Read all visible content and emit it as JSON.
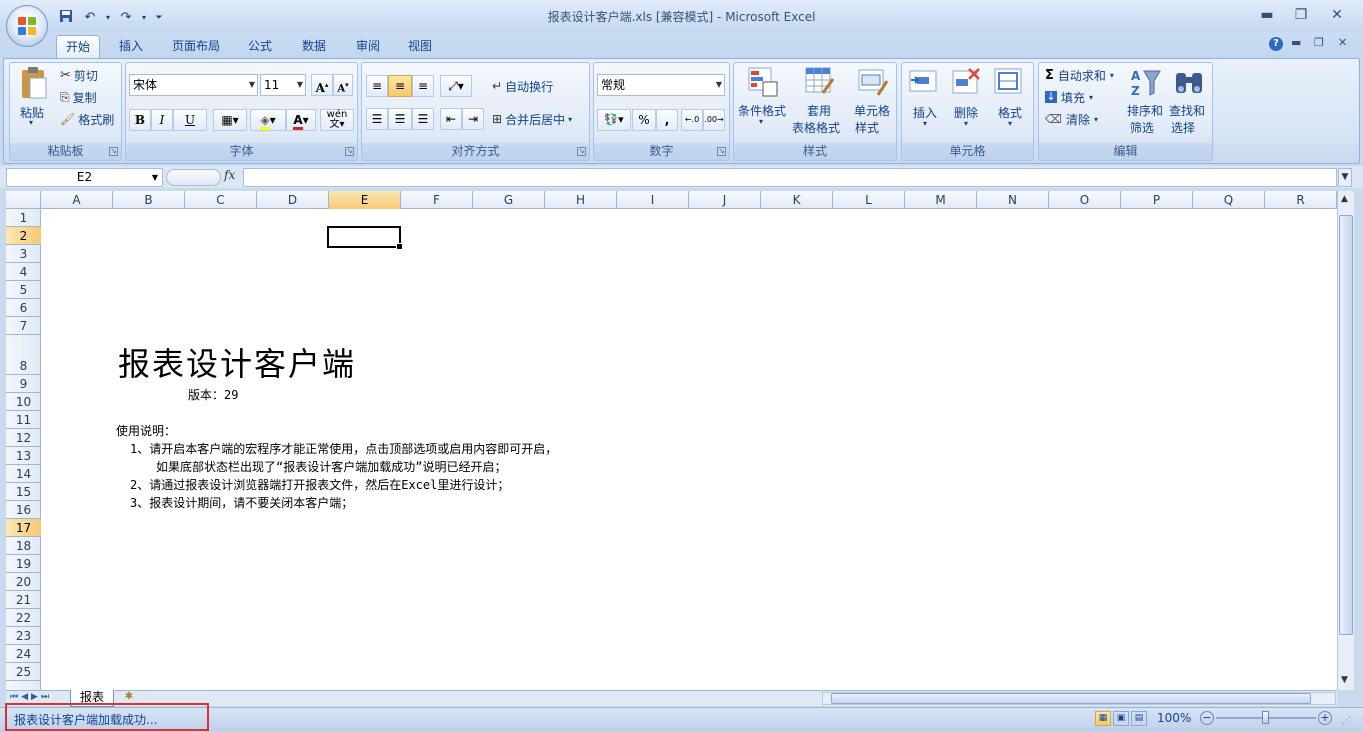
{
  "window": {
    "title": "报表设计客户端.xls  [兼容模式] - Microsoft Excel",
    "controls": {
      "minimize": "▬",
      "restore": "❐",
      "close": "✕"
    }
  },
  "quick_access": {
    "save_icon": "save-icon",
    "undo": "↶",
    "redo": "↷"
  },
  "tabs": [
    "开始",
    "插入",
    "页面布局",
    "公式",
    "数据",
    "审阅",
    "视图"
  ],
  "ribbon": {
    "clipboard": {
      "label": "粘贴板",
      "paste": "粘贴",
      "cut": "剪切",
      "copy": "复制",
      "format_painter": "格式刷"
    },
    "font": {
      "label": "字体",
      "font_name": "宋体",
      "font_size": "11",
      "bold": "B",
      "italic": "I",
      "underline": "U",
      "wen": "wén"
    },
    "alignment": {
      "label": "对齐方式",
      "wrap_text": "自动换行",
      "merge_center": "合并后居中"
    },
    "number": {
      "label": "数字",
      "format": "常规",
      "percent": "%",
      "comma": ",",
      "inc_decimal": ".00",
      "dec_decimal": ".00"
    },
    "styles": {
      "label": "样式",
      "conditional": "条件格式",
      "table_format_1": "套用",
      "table_format_2": "表格格式",
      "cell_style_1": "单元格",
      "cell_style_2": "样式"
    },
    "cells": {
      "label": "单元格",
      "insert": "插入",
      "delete": "删除",
      "format": "格式"
    },
    "editing": {
      "label": "编辑",
      "autosum": "自动求和",
      "fill": "填充",
      "clear": "清除",
      "sort_1": "排序和",
      "sort_2": "筛选",
      "find_1": "查找和",
      "find_2": "选择"
    }
  },
  "formula_bar": {
    "name_box": "E2",
    "fx": "fx",
    "value": ""
  },
  "columns": [
    "A",
    "B",
    "C",
    "D",
    "E",
    "F",
    "G",
    "H",
    "I",
    "J",
    "K",
    "L",
    "M",
    "N",
    "O",
    "P",
    "Q",
    "R"
  ],
  "rows": [
    "1",
    "2",
    "3",
    "4",
    "5",
    "6",
    "7",
    "8",
    "9",
    "10",
    "11",
    "12",
    "13",
    "14",
    "15",
    "16",
    "17",
    "18",
    "19",
    "20",
    "21",
    "22",
    "23",
    "24",
    "25"
  ],
  "selected": {
    "column": "E",
    "row": "2",
    "highlighted_row": "17"
  },
  "sheet": {
    "title": "报表设计客户端",
    "version": "版本：29",
    "usage_header": "使用说明：",
    "line1": "1、请开启本客户端的宏程序才能正常使用，点击顶部选项或启用内容即可开启，",
    "line1b": "如果底部状态栏出现了“报表设计客户端加载成功”说明已经开启；",
    "line2": "2、请通过报表设计浏览器端打开报表文件，然后在Excel里进行设计；",
    "line3": "3、报表设计期间，请不要关闭本客户端；"
  },
  "sheet_tabs": [
    "报表"
  ],
  "status": {
    "text": "报表设计客户端加载成功...",
    "zoom": "100%"
  },
  "colors": {
    "accent": "#15428b",
    "ribbon_bg": "#dbe7f6",
    "selection": "#f7c975",
    "highlight_box": "#e03030"
  }
}
